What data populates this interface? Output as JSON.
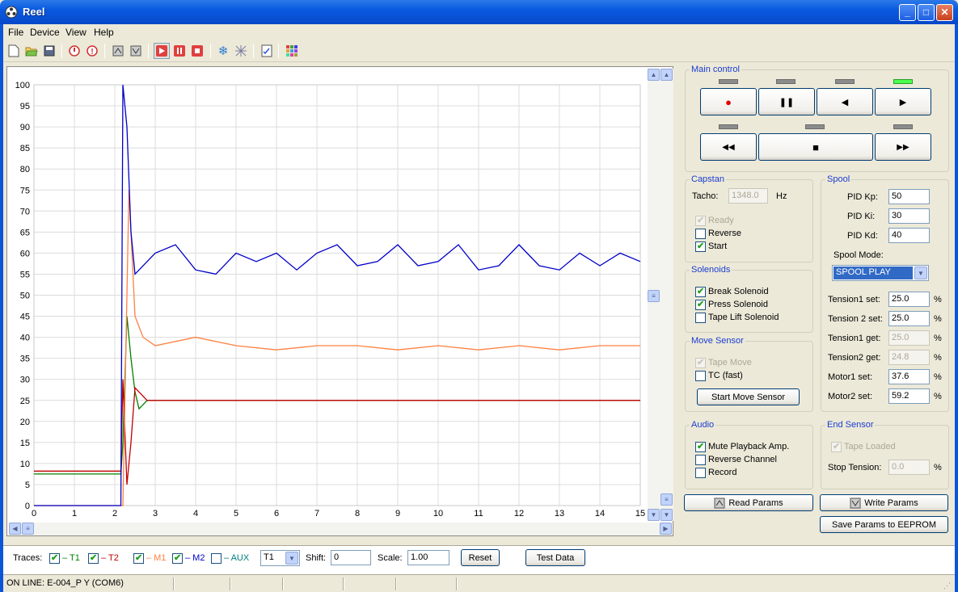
{
  "window": {
    "title": "Reel"
  },
  "menu": {
    "file": "File",
    "device": "Device",
    "view": "View",
    "help": "Help"
  },
  "main_control": {
    "legend": "Main control",
    "leds_row1": [
      false,
      false,
      false,
      true
    ],
    "leds_row2": [
      false,
      false,
      false
    ],
    "record_glyph": "●",
    "pause_glyph": "❚❚",
    "back_glyph": "◀",
    "play_glyph": "▶",
    "rewind_glyph": "◀◀",
    "stop_glyph": "■",
    "ffwd_glyph": "▶▶"
  },
  "capstan": {
    "legend": "Capstan",
    "tacho_label": "Tacho:",
    "tacho_value": "1348.0",
    "tacho_unit": "Hz",
    "ready": "Ready",
    "ready_checked": true,
    "reverse": "Reverse",
    "reverse_checked": false,
    "start": "Start",
    "start_checked": true
  },
  "spool": {
    "legend": "Spool",
    "kp_label": "PID Kp:",
    "kp": "50",
    "ki_label": "PID Ki:",
    "ki": "30",
    "kd_label": "PID Kd:",
    "kd": "40",
    "mode_label": "Spool Mode:",
    "mode": "SPOOL PLAY",
    "tension1_set_label": "Tension1 set:",
    "tension1_set": "25.0",
    "tension2_set_label": "Tension 2 set:",
    "tension2_set": "25.0",
    "tension1_get_label": "Tension1 get:",
    "tension1_get": "25.0",
    "tension2_get_label": "Tension2 get:",
    "tension2_get": "24.8",
    "motor1_set_label": "Motor1 set:",
    "motor1_set": "37.6",
    "motor2_set_label": "Motor2 set:",
    "motor2_set": "59.2",
    "unit": "%"
  },
  "solenoids": {
    "legend": "Solenoids",
    "break": "Break Solenoid",
    "break_checked": true,
    "press": "Press Solenoid",
    "press_checked": true,
    "lift": "Tape Lift Solenoid",
    "lift_checked": false
  },
  "move_sensor": {
    "legend": "Move Sensor",
    "tape_move": "Tape Move",
    "tape_move_checked": true,
    "tc": "TC (fast)",
    "tc_checked": false,
    "start_button": "Start Move Sensor"
  },
  "audio": {
    "legend": "Audio",
    "mute": "Mute Playback Amp.",
    "mute_checked": true,
    "reverse": "Reverse Channel",
    "reverse_checked": false,
    "record": "Record",
    "record_checked": false
  },
  "end_sensor": {
    "legend": "End Sensor",
    "loaded": "Tape Loaded",
    "loaded_checked": true,
    "stop_label": "Stop Tension:",
    "stop_value": "0.0",
    "unit": "%"
  },
  "buttons": {
    "read": "Read Params",
    "write": "Write Params",
    "save": "Save Params to EEPROM"
  },
  "traces": {
    "label": "Traces:",
    "t1": "– T1",
    "t2": "– T2",
    "m1": "– M1",
    "m2": "– M2",
    "aux": "– AUX",
    "t1_checked": true,
    "t2_checked": true,
    "m1_checked": true,
    "m2_checked": true,
    "aux_checked": false,
    "select": "T1",
    "shift_label": "Shift:",
    "shift": "0",
    "scale_label": "Scale:",
    "scale": "1.00",
    "reset": "Reset",
    "test": "Test Data",
    "colors": {
      "t1": "#008000",
      "t2": "#c00000",
      "m1": "#ff8040",
      "m2": "#0000c8",
      "aux": "#008080"
    }
  },
  "status": {
    "text": "ON LINE: E-004_P Y (COM6)"
  },
  "chart_data": {
    "type": "line",
    "xlim": [
      0,
      15
    ],
    "ylim": [
      0,
      100
    ],
    "xticks": [
      "0",
      "1",
      "2",
      "3",
      "4",
      "5",
      "6",
      "7",
      "8",
      "9",
      "10",
      "11",
      "12",
      "13",
      "14",
      "15"
    ],
    "yticks": [
      "0",
      "5",
      "10",
      "15",
      "20",
      "25",
      "30",
      "35",
      "40",
      "45",
      "50",
      "55",
      "60",
      "65",
      "70",
      "75",
      "80",
      "85",
      "90",
      "95",
      "100"
    ],
    "grid": true,
    "series": [
      {
        "name": "T1",
        "color": "#008000",
        "x": [
          0,
          2.15,
          2.2,
          2.3,
          2.4,
          2.5,
          2.6,
          2.8,
          3,
          5,
          10,
          15
        ],
        "y": [
          7.5,
          7.5,
          15,
          45,
          35,
          27,
          23,
          25,
          25,
          25,
          25,
          25
        ]
      },
      {
        "name": "T2",
        "color": "#c00000",
        "x": [
          0,
          2.15,
          2.2,
          2.3,
          2.4,
          2.5,
          2.6,
          2.8,
          3,
          5,
          10,
          15
        ],
        "y": [
          8.2,
          8.2,
          30,
          5,
          15,
          28,
          27,
          25,
          25,
          25,
          25,
          25
        ]
      },
      {
        "name": "M1",
        "color": "#ff8040",
        "x": [
          0,
          2.2,
          2.35,
          2.5,
          2.7,
          3,
          4,
          5,
          6,
          7,
          8,
          9,
          10,
          11,
          12,
          13,
          14,
          15
        ],
        "y": [
          0,
          0,
          75,
          45,
          40,
          38,
          40,
          38,
          37,
          38,
          38,
          37,
          38,
          37,
          38,
          37,
          38,
          38
        ]
      },
      {
        "name": "M2",
        "color": "#0000c8",
        "x": [
          0,
          2.15,
          2.2,
          2.3,
          2.4,
          2.5,
          2.6,
          3,
          3.5,
          4,
          4.5,
          5,
          5.5,
          6,
          6.5,
          7,
          7.5,
          8,
          8.5,
          9,
          9.5,
          10,
          10.5,
          11,
          11.5,
          12,
          12.5,
          13,
          13.5,
          14,
          14.5,
          15
        ],
        "y": [
          0,
          0,
          100,
          90,
          65,
          55,
          56,
          60,
          62,
          56,
          55,
          60,
          58,
          60,
          56,
          60,
          62,
          57,
          58,
          62,
          57,
          58,
          62,
          56,
          57,
          62,
          57,
          56,
          60,
          57,
          60,
          58
        ]
      }
    ]
  }
}
